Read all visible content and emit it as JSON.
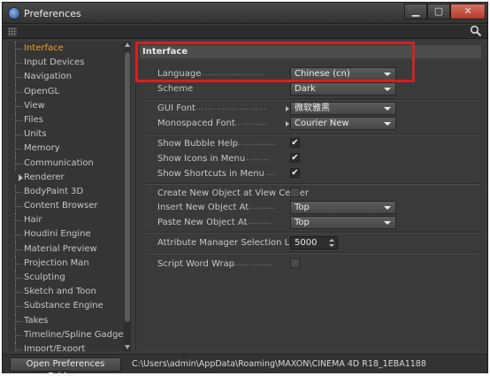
{
  "window": {
    "title": "Preferences"
  },
  "sidebar": {
    "items": [
      {
        "label": "Interface",
        "active": true
      },
      {
        "label": "Input Devices"
      },
      {
        "label": "Navigation"
      },
      {
        "label": "OpenGL"
      },
      {
        "label": "View"
      },
      {
        "label": "Files"
      },
      {
        "label": "Units"
      },
      {
        "label": "Memory"
      },
      {
        "label": "Communication"
      },
      {
        "label": "Renderer",
        "expandable": true
      },
      {
        "label": "BodyPaint 3D"
      },
      {
        "label": "Content Browser"
      },
      {
        "label": "Hair"
      },
      {
        "label": "Houdini Engine"
      },
      {
        "label": "Material Preview"
      },
      {
        "label": "Projection Man"
      },
      {
        "label": "Sculpting"
      },
      {
        "label": "Sketch and Toon"
      },
      {
        "label": "Substance Engine"
      },
      {
        "label": "Takes"
      },
      {
        "label": "Timeline/Spline Gadget"
      },
      {
        "label": "Import/Export"
      }
    ]
  },
  "panel": {
    "header": "Interface",
    "language": {
      "label": "Language",
      "dots": "......................",
      "value": "Chinese (cn)"
    },
    "scheme": {
      "label": "Scheme",
      "dots": "",
      "value": "Dark"
    },
    "gui_font": {
      "label": "GUI Font",
      "dots": "........................",
      "value": "微软雅黑"
    },
    "mono_font": {
      "label": "Monospaced Font",
      "dots": "............",
      "value": "Courier New"
    },
    "bubble_help": {
      "label": "Show Bubble Help",
      "dots": "...............",
      "checked": true
    },
    "icons_menu": {
      "label": "Show Icons in Menu",
      "dots": "...........",
      "checked": true
    },
    "shortcuts_menu": {
      "label": "Show Shortcuts in Menu",
      "dots": "........",
      "checked": true
    },
    "create_new": {
      "label": "Create New Object at View Center",
      "checked": false
    },
    "insert_new": {
      "label": "Insert New Object At",
      "dots": "...........",
      "value": "Top"
    },
    "paste_new": {
      "label": "Paste New Object At",
      "dots": "...........",
      "value": "Top"
    },
    "attr_limit": {
      "label": "Attribute Manager Selection Limit",
      "value": "5000"
    },
    "script_wrap": {
      "label": "Script Word Wrap",
      "dots": "...............",
      "checked": false
    }
  },
  "footer": {
    "button": "Open Preferences Folder...",
    "path": "C:\\Users\\admin\\AppData\\Roaming\\MAXON\\CINEMA 4D R18_1EBA1188"
  },
  "colors": {
    "active_item": "#f0a020",
    "highlight": "#d02222",
    "background": "#3a3a3a"
  },
  "icons": {
    "app": "cinema4d-app-icon",
    "search": "search-icon",
    "check": "checkmark-icon"
  }
}
